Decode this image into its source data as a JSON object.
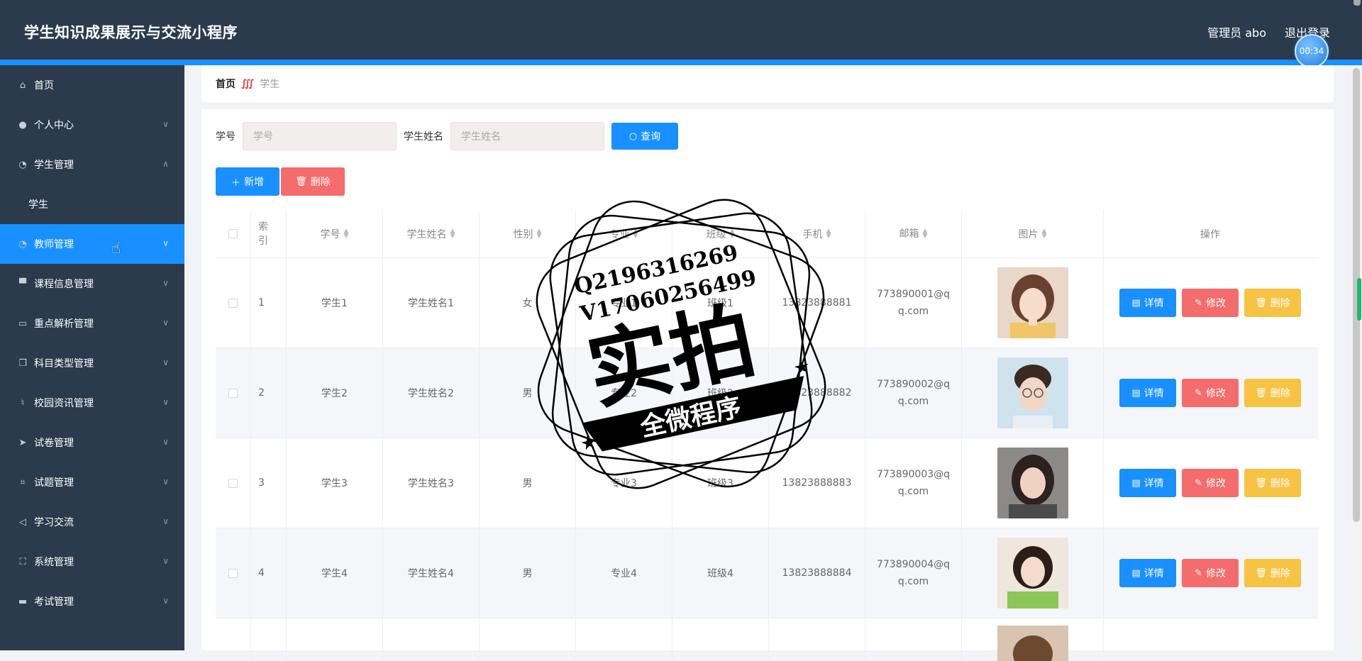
{
  "app": {
    "title": "学生知识成果展示与交流小程序",
    "admin_label": "管理员 abo",
    "logout_label": "退出登录",
    "timer": "00:34"
  },
  "sidebar": {
    "items": [
      {
        "label": "首页",
        "icon": "home-icon"
      },
      {
        "label": "个人中心",
        "icon": "user-icon"
      },
      {
        "label": "学生管理",
        "icon": "dashboard-icon"
      },
      {
        "label": "学生",
        "icon": ""
      },
      {
        "label": "教师管理",
        "icon": "dashboard-icon"
      },
      {
        "label": "课程信息管理",
        "icon": "stamp-icon"
      },
      {
        "label": "重点解析管理",
        "icon": "chat-icon"
      },
      {
        "label": "科目类型管理",
        "icon": "copy-icon"
      },
      {
        "label": "校园资讯管理",
        "icon": "microphone-icon"
      },
      {
        "label": "试卷管理",
        "icon": "send-icon"
      },
      {
        "label": "试题管理",
        "icon": "crop-icon"
      },
      {
        "label": "学习交流",
        "icon": "location-icon"
      },
      {
        "label": "系统管理",
        "icon": "fullscreen-icon"
      },
      {
        "label": "考试管理",
        "icon": "suitcase-icon"
      }
    ]
  },
  "breadcrumb": {
    "home": "首页",
    "separator": "∭",
    "current": "学生"
  },
  "search": {
    "sno_label": "学号",
    "sno_placeholder": "学号",
    "name_label": "学生姓名",
    "name_placeholder": "学生姓名",
    "query_label": "查询"
  },
  "actions": {
    "add_label": "新增",
    "delete_label": "删除"
  },
  "table": {
    "headers": {
      "index": "索引",
      "sno": "学号",
      "name": "学生姓名",
      "sex": "性别",
      "major": "专业",
      "class": "班级",
      "phone": "手机",
      "mail": "邮箱",
      "pic": "图片",
      "op": "操作"
    },
    "rows": [
      {
        "index": "1",
        "sno": "学生1",
        "name": "学生姓名1",
        "sex": "女",
        "major": "专业1",
        "class": "班级1",
        "phone": "13823888881",
        "mail": "773890001@qq.com"
      },
      {
        "index": "2",
        "sno": "学生2",
        "name": "学生姓名2",
        "sex": "男",
        "major": "专业2",
        "class": "班级2",
        "phone": "13823888882",
        "mail": "773890002@qq.com"
      },
      {
        "index": "3",
        "sno": "学生3",
        "name": "学生姓名3",
        "sex": "男",
        "major": "专业3",
        "class": "班级3",
        "phone": "13823888883",
        "mail": "773890003@qq.com"
      },
      {
        "index": "4",
        "sno": "学生4",
        "name": "学生姓名4",
        "sex": "男",
        "major": "专业4",
        "class": "班级4",
        "phone": "13823888884",
        "mail": "773890004@qq.com"
      }
    ],
    "op_labels": {
      "detail": "详情",
      "edit": "修改",
      "delete": "删除"
    }
  },
  "watermark": {
    "line1": "Q2196316269",
    "line2": "V17060256499",
    "big": "实拍",
    "banner": "全微程序"
  },
  "colors": {
    "header_bg": "#2b3a4d",
    "accent": "#1890ff",
    "danger": "#f56c6c",
    "warning": "#f6c343"
  }
}
